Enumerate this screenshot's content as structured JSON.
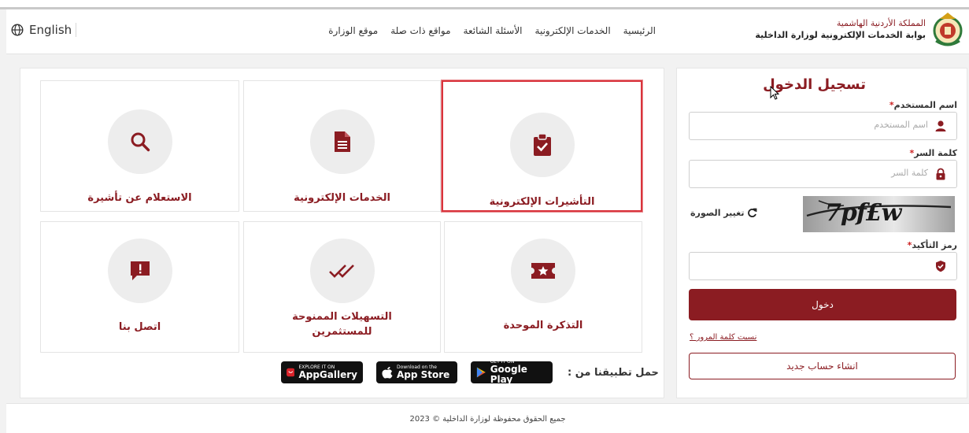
{
  "header": {
    "language_label": "English",
    "nav": [
      "الرئيسية",
      "الخدمات الإلكترونية",
      "الأسئلة الشائعة",
      "مواقع ذات صلة",
      "موقع الوزارة"
    ],
    "brand_line1": "المملكة الأردنية الهاشمية",
    "brand_line2": "بوابة الخدمات الإلكترونية لوزارة الداخلية"
  },
  "services": {
    "tiles": [
      {
        "label": "التأشيرات الإلكترونية",
        "icon": "clipboard-check-icon",
        "selected": true
      },
      {
        "label": "الخدمات الإلكترونية",
        "icon": "document-icon"
      },
      {
        "label": "الاستعلام عن تأشيرة",
        "icon": "search-icon"
      },
      {
        "label": "التذكرة الموحدة",
        "icon": "ticket-star-icon"
      },
      {
        "label": "التسهيلات الممنوحة للمستثمرين",
        "icon": "double-check-icon"
      },
      {
        "label": "اتصل بنا",
        "icon": "chat-alert-icon"
      }
    ],
    "app_label": "حمل تطبيقنا من :",
    "badges": {
      "google_top": "GET IT ON",
      "google_main": "Google Play",
      "apple_top": "Download on the",
      "apple_main": "App Store",
      "huawei_top": "EXPLORE IT ON",
      "huawei_main": "AppGallery"
    }
  },
  "login": {
    "title": "تسجيل الدخول",
    "username_label": "اسم المستخدم",
    "username_placeholder": "اسم المستخدم",
    "password_label": "كلمة السر",
    "password_placeholder": "كلمة السر",
    "change_image": "تغيير الصورة",
    "captcha_text": "7pf£w",
    "confirm_label": "رمز التأكيد",
    "login_button": "دخول",
    "forgot": "نسيت كلمة المرور ؟",
    "create_account": "انشاء حساب جديد"
  },
  "footer": {
    "copyright": "جميع الحقوق محفوظة لوزارة الداخلية © 2023"
  },
  "colors": {
    "brand": "#8b1c22",
    "highlight": "#d9343c"
  }
}
